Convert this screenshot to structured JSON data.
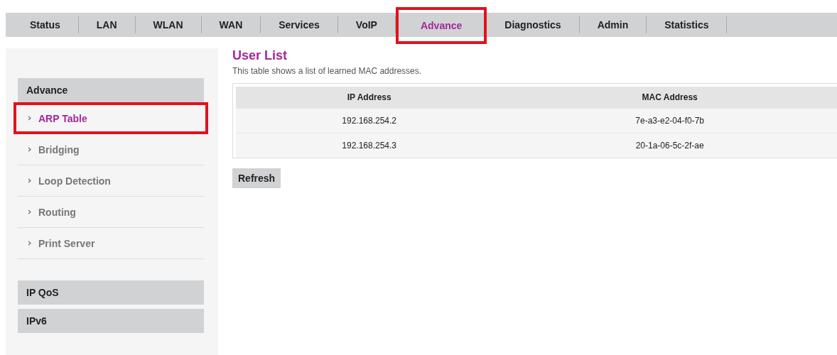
{
  "tabs": [
    {
      "label": "Status",
      "selected": false,
      "highlighted": false
    },
    {
      "label": "LAN",
      "selected": false,
      "highlighted": false
    },
    {
      "label": "WLAN",
      "selected": false,
      "highlighted": false
    },
    {
      "label": "WAN",
      "selected": false,
      "highlighted": false
    },
    {
      "label": "Services",
      "selected": false,
      "highlighted": false
    },
    {
      "label": "VoIP",
      "selected": false,
      "highlighted": false
    },
    {
      "label": "Advance",
      "selected": true,
      "highlighted": true
    },
    {
      "label": "Diagnostics",
      "selected": false,
      "highlighted": false
    },
    {
      "label": "Admin",
      "selected": false,
      "highlighted": false
    },
    {
      "label": "Statistics",
      "selected": false,
      "highlighted": false
    }
  ],
  "sidebar": {
    "sections": [
      {
        "title": "Advance",
        "items": [
          {
            "label": "ARP Table",
            "selected": true,
            "highlighted": true
          },
          {
            "label": "Bridging",
            "selected": false,
            "highlighted": false
          },
          {
            "label": "Loop Detection",
            "selected": false,
            "highlighted": false
          },
          {
            "label": "Routing",
            "selected": false,
            "highlighted": false
          },
          {
            "label": "Print Server",
            "selected": false,
            "highlighted": false
          }
        ]
      },
      {
        "title": "IP QoS"
      },
      {
        "title": "IPv6"
      }
    ]
  },
  "content": {
    "title": "User List",
    "description": "This table shows a list of learned MAC addresses.",
    "table": {
      "columns": [
        "IP Address",
        "MAC Address"
      ],
      "rows": [
        [
          "192.168.254.2",
          "7e-a3-e2-04-f0-7b"
        ],
        [
          "192.168.254.3",
          "20-1a-06-5c-2f-ae"
        ]
      ]
    },
    "buttons": [
      "Refresh"
    ]
  }
}
